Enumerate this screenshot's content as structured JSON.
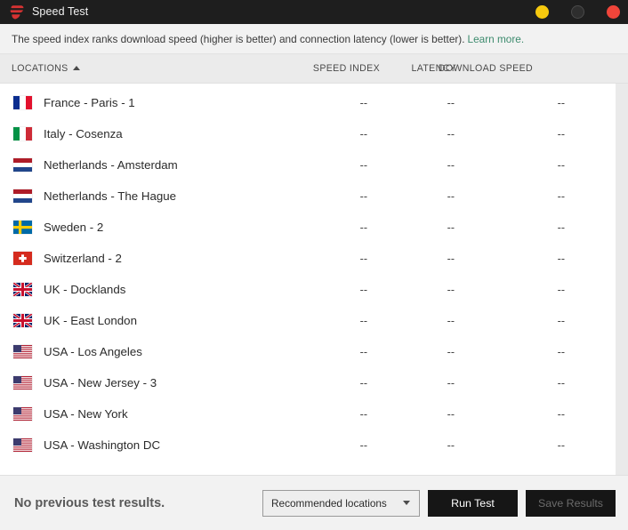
{
  "window": {
    "title": "Speed Test",
    "logo_icon": "expressvpn-logo-icon",
    "controls": [
      {
        "name": "minimize",
        "icon": "minimize-circle-icon",
        "color": "#f6c90e"
      },
      {
        "name": "maximize",
        "icon": "maximize-circle-icon",
        "color": "#2e2e2e"
      },
      {
        "name": "close",
        "icon": "close-circle-icon",
        "color": "#f0453a"
      }
    ]
  },
  "info_bar": {
    "text": "The speed index ranks download speed (higher is better) and connection latency (lower is better).",
    "link_label": "Learn more.",
    "link_color": "#3d8b6e"
  },
  "table": {
    "headers": {
      "locations": "LOCATIONS",
      "sort_icon": "sort-ascending-caret-icon",
      "speed_index": "SPEED INDEX",
      "latency": "LATENCY",
      "download_speed": "DOWNLOAD SPEED"
    },
    "empty_value": "--",
    "rows": [
      {
        "flag": "flag-france",
        "location": "France - Paris - 1",
        "speed_index": "--",
        "latency": "--",
        "download_speed": "--"
      },
      {
        "flag": "flag-italy",
        "location": "Italy - Cosenza",
        "speed_index": "--",
        "latency": "--",
        "download_speed": "--"
      },
      {
        "flag": "flag-netherlands",
        "location": "Netherlands - Amsterdam",
        "speed_index": "--",
        "latency": "--",
        "download_speed": "--"
      },
      {
        "flag": "flag-netherlands",
        "location": "Netherlands - The Hague",
        "speed_index": "--",
        "latency": "--",
        "download_speed": "--"
      },
      {
        "flag": "flag-sweden",
        "location": "Sweden - 2",
        "speed_index": "--",
        "latency": "--",
        "download_speed": "--"
      },
      {
        "flag": "flag-switzerland",
        "location": "Switzerland - 2",
        "speed_index": "--",
        "latency": "--",
        "download_speed": "--"
      },
      {
        "flag": "flag-uk",
        "location": "UK - Docklands",
        "speed_index": "--",
        "latency": "--",
        "download_speed": "--"
      },
      {
        "flag": "flag-uk",
        "location": "UK - East London",
        "speed_index": "--",
        "latency": "--",
        "download_speed": "--"
      },
      {
        "flag": "flag-usa",
        "location": "USA - Los Angeles",
        "speed_index": "--",
        "latency": "--",
        "download_speed": "--"
      },
      {
        "flag": "flag-usa",
        "location": "USA - New Jersey - 3",
        "speed_index": "--",
        "latency": "--",
        "download_speed": "--"
      },
      {
        "flag": "flag-usa",
        "location": "USA - New York",
        "speed_index": "--",
        "latency": "--",
        "download_speed": "--"
      },
      {
        "flag": "flag-usa",
        "location": "USA - Washington DC",
        "speed_index": "--",
        "latency": "--",
        "download_speed": "--"
      }
    ]
  },
  "footer": {
    "status": "No previous test results.",
    "location_select": {
      "value": "Recommended locations",
      "caret_icon": "chevron-down-icon"
    },
    "run_button": "Run Test",
    "save_button": "Save Results"
  }
}
